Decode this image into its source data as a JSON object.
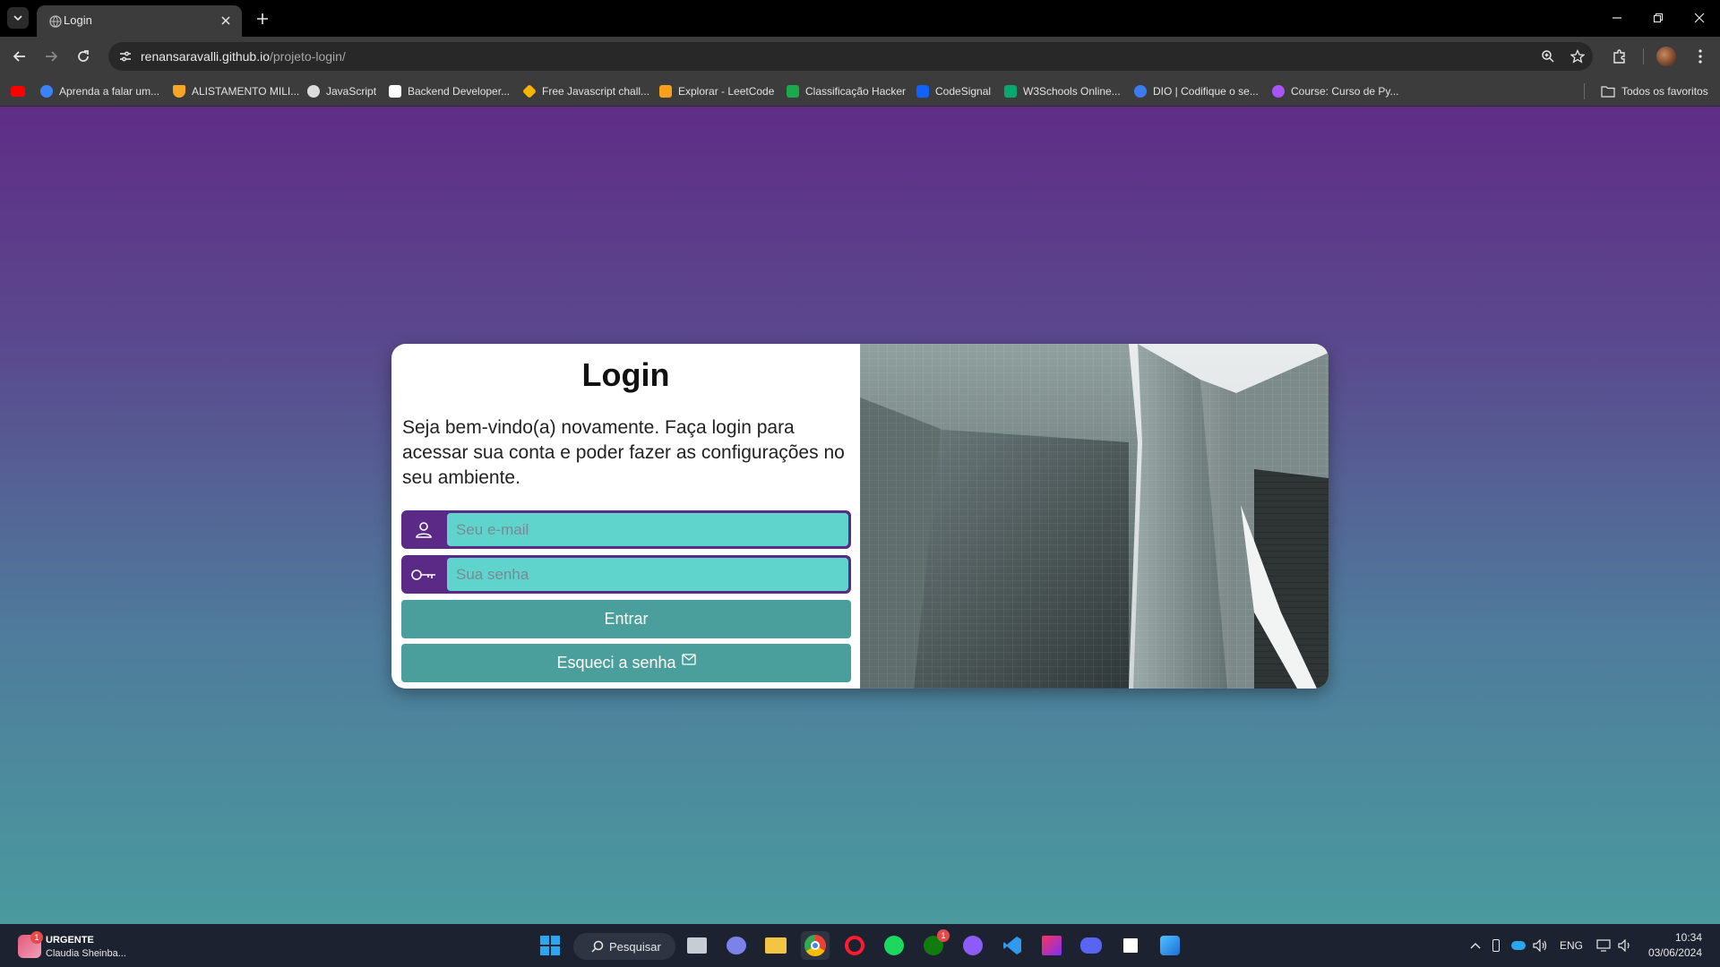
{
  "browser": {
    "tab_title": "Login",
    "url_host": "renansaravalli.github.io",
    "url_path": "/projeto-login/",
    "bookmarks": [
      {
        "label": "",
        "icon": "youtube-icon",
        "color": "#ff0000"
      },
      {
        "label": "Aprenda a falar um...",
        "icon": "person-icon",
        "color": "#3b82f6"
      },
      {
        "label": "ALISTAMENTO MILI...",
        "icon": "shield-icon",
        "color": "#f6a623"
      },
      {
        "label": "JavaScript",
        "icon": "globe-icon",
        "color": "#dddddd"
      },
      {
        "label": "Backend Developer...",
        "icon": "roadmap-icon",
        "color": "#ffffff"
      },
      {
        "label": "Free Javascript chall...",
        "icon": "diamond-icon",
        "color": "#f5b400"
      },
      {
        "label": "Explorar - LeetCode",
        "icon": "leetcode-icon",
        "color": "#f89f1b"
      },
      {
        "label": "Classificação Hacker",
        "icon": "hackerrank-icon",
        "color": "#1ba94c"
      },
      {
        "label": "CodeSignal",
        "icon": "codesignal-icon",
        "color": "#1062fb"
      },
      {
        "label": "W3Schools Online...",
        "icon": "w3schools-icon",
        "color": "#04aa6d"
      },
      {
        "label": "DIO | Codifique o se...",
        "icon": "dio-icon",
        "color": "#3d7cf0"
      },
      {
        "label": "Course: Curso de Py...",
        "icon": "course-icon",
        "color": "#a855f7"
      }
    ],
    "all_bookmarks": "Todos os favoritos"
  },
  "login": {
    "title": "Login",
    "welcome": "Seja bem-vindo(a) novamente. Faça login para acessar sua conta e poder fazer as configurações no seu ambiente.",
    "email_placeholder": "Seu e-mail",
    "password_placeholder": "Sua senha",
    "submit_label": "Entrar",
    "forgot_label": "Esqueci a senha"
  },
  "colors": {
    "accent_purple": "#5b2a86",
    "input_teal": "#5fd4cc",
    "button_teal": "#4a9f9c"
  },
  "taskbar": {
    "news_badge": "1",
    "news_title": "URGENTE",
    "news_subtitle": "Claudia Sheinba...",
    "search_label": "Pesquisar",
    "xbox_badge": "1",
    "language": "ENG",
    "time": "10:34",
    "date": "03/06/2024"
  }
}
